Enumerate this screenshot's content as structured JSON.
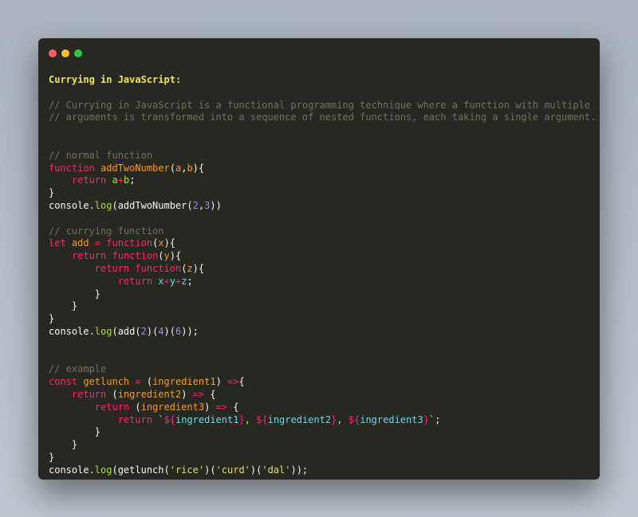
{
  "window": {
    "controls": [
      "close",
      "minimize",
      "maximize"
    ]
  },
  "colors": {
    "background": "#272822",
    "comment": "#75715e",
    "keyword": "#f92672",
    "function_name": "#fd971f",
    "number": "#ae81ff",
    "string": "#e6db74",
    "method": "#a6e22e",
    "title": "#f4e44e"
  },
  "code": {
    "title": "Currying in JavaScript:",
    "comment1": "// Currying in JavaScript is a functional programming technique where a function with multiple",
    "comment2": "// arguments is transformed into a sequence of nested functions, each taking a single argument.",
    "normal_comment": "// normal function",
    "curry_comment": "// currying function",
    "example_comment": "// example"
  }
}
